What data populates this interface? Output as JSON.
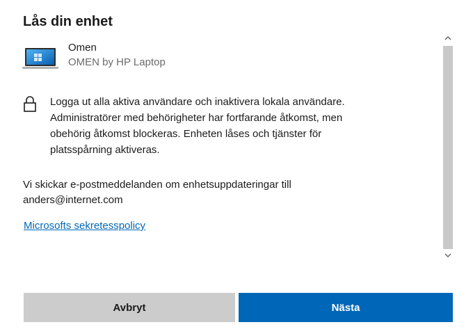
{
  "dialog": {
    "title": "Lås din enhet"
  },
  "device": {
    "icon": "laptop-icon",
    "name": "Omen",
    "model": "OMEN by HP Laptop"
  },
  "lock_info": {
    "icon": "lock-icon",
    "lines": [
      "Logga ut alla aktiva användare och inaktivera lokala användare.",
      "Administratörer med behörigheter har fortfarande åtkomst, men",
      "obehörig åtkomst blockeras. Enheten låses och tjänster för",
      "platsspårning aktiveras."
    ]
  },
  "email_notice": {
    "line1": "Vi skickar e-postmeddelanden om enhetsuppdateringar till",
    "email": "anders@internet.com"
  },
  "privacy_link": {
    "label": "Microsofts sekretesspolicy"
  },
  "scrollbar": {
    "up_icon": "chevron-up-icon",
    "down_icon": "chevron-down-icon"
  },
  "buttons": {
    "cancel_label": "Avbryt",
    "next_label": "Nästa"
  },
  "colors": {
    "accent": "#0067b8",
    "secondary_button": "#cccccc",
    "muted_text": "#6b6b6b"
  }
}
